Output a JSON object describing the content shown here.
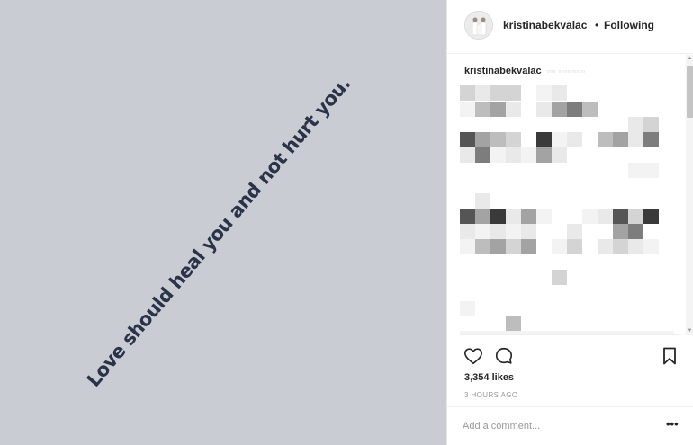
{
  "post_image": {
    "quote": "Love should heal you and not hurt you.",
    "background_color": "#c9ccd3",
    "text_color": "#2b3348"
  },
  "header": {
    "username": "kristinabekvalac",
    "separator": "•",
    "follow_status": "Following",
    "avatar_icon": "profile-photo"
  },
  "caption": {
    "username": "kristinabekvalac",
    "text_obscured": "▫▫▫ ▫▫▫▫▫▫▫▫▫"
  },
  "comments": {
    "obscured": true,
    "pixel_palette": [
      "#e9e9e9",
      "#d4d4d4",
      "#bdbdbd",
      "#a3a3a3",
      "#7d7d7d",
      "#555555",
      "#3a3a3a",
      "#f3f3f3"
    ]
  },
  "actions": {
    "like_icon": "heart-outline",
    "comment_icon": "speech-bubble-outline",
    "save_icon": "bookmark-outline"
  },
  "likes_text": "3,354 likes",
  "timestamp": "3 HOURS AGO",
  "comment_box": {
    "placeholder": "Add a comment...",
    "more_label": "•••"
  }
}
